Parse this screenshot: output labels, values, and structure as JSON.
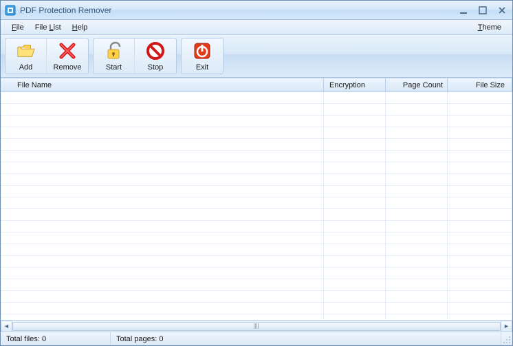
{
  "window": {
    "title": "PDF Protection Remover"
  },
  "menu": {
    "file": "File",
    "filelist": "File List",
    "help": "Help",
    "theme": "Theme"
  },
  "toolbar": {
    "add": "Add",
    "remove": "Remove",
    "start": "Start",
    "stop": "Stop",
    "exit": "Exit"
  },
  "columns": {
    "filename": "File Name",
    "encryption": "Encryption",
    "pagecount": "Page Count",
    "filesize": "File Size"
  },
  "status": {
    "totalfiles_label": "Total files:",
    "totalfiles_value": "0",
    "totalpages_label": "Total pages:",
    "totalpages_value": "0"
  }
}
